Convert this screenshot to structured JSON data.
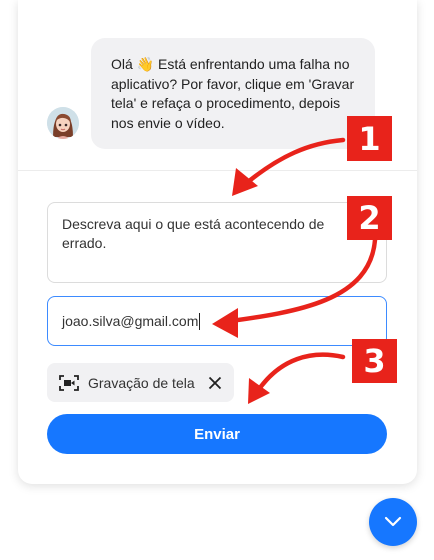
{
  "chat": {
    "greeting_emoji": "👋",
    "message_before_emoji": "Olá ",
    "message_after_emoji": " Está enfrentando uma falha no aplicativo? Por favor, clique em 'Gravar tela' e refaça o procedimento, depois nos envie o vídeo.",
    "avatar_icon": "user-avatar"
  },
  "form": {
    "description_placeholder": "Descreva aqui o que está acontecendo de errado.",
    "email_value": "joao.silva@gmail.com",
    "recording_chip_label": "Gravação de tela",
    "send_label": "Enviar"
  },
  "annotations": {
    "step1": "1",
    "step2": "2",
    "step3": "3",
    "color": "#e8231b"
  },
  "colors": {
    "accent": "#1677ff",
    "annotation": "#e8231b"
  },
  "icons": {
    "recording": "screen-record-icon",
    "remove": "close-icon",
    "collapse": "chevron-down-icon"
  }
}
